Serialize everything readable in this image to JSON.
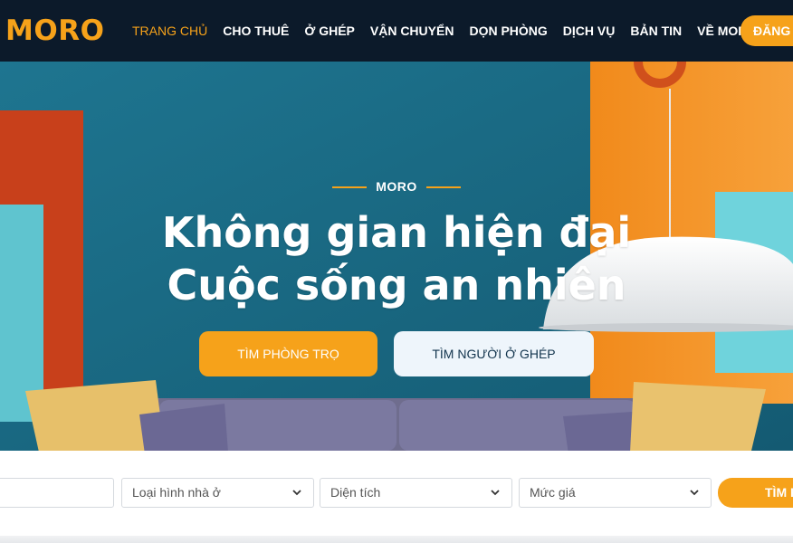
{
  "brand": {
    "logo_text": "MORO"
  },
  "nav": {
    "items": [
      {
        "label": "TRANG CHỦ",
        "active": true
      },
      {
        "label": "CHO THUÊ",
        "active": false
      },
      {
        "label": "Ở GHÉP",
        "active": false
      },
      {
        "label": "VẬN CHUYỂN",
        "active": false
      },
      {
        "label": "DỌN PHÒNG",
        "active": false
      },
      {
        "label": "DỊCH VỤ",
        "active": false
      },
      {
        "label": "BẢN TIN",
        "active": false
      },
      {
        "label": "VỀ MORO",
        "active": false
      }
    ],
    "login_label": "ĐĂNG"
  },
  "hero": {
    "eyebrow": "MORO",
    "headline_line1": "Không gian hiện đại",
    "headline_line2": "Cuộc sống an nhiên",
    "cta_primary": "TÌM PHÒNG TRỌ",
    "cta_secondary": "TÌM NGƯỜI Ở GHÉP"
  },
  "search": {
    "keyword_value": "",
    "type_placeholder": "Loại hình nhà ở",
    "area_placeholder": "Diện tích",
    "price_placeholder": "Mức giá",
    "button_label": "TÌM K"
  },
  "icons": {
    "dropdown": "chevron-down-icon"
  },
  "colors": {
    "accent": "#f6a21a",
    "navbar_bg": "#0c1a2a",
    "hero_wall": "#1b6e88",
    "secondary_button_bg": "#eef5fb"
  }
}
